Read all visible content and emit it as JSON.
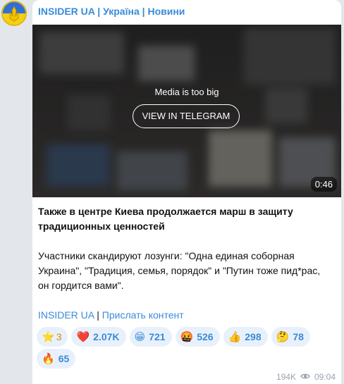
{
  "channel": {
    "name": "INSIDER UA | Україна | Новини"
  },
  "media": {
    "message": "Media is too big",
    "button_label": "VIEW IN TELEGRAM",
    "duration": "0:46"
  },
  "post": {
    "title": "Также в центре Киева продолжается марш в защиту традиционных ценностей",
    "body": "Участники скандируют лозунги: \"Одна единая соборная Украина\", \"Традиция, семья, порядок\" и \"Путин тоже пид*рас, он гордится вами\".",
    "link_channel": "INSIDER UA",
    "separator": " | ",
    "link_submit": "Прислать контент"
  },
  "reactions": [
    {
      "emoji": "⭐",
      "count": "3",
      "icon": "star-icon"
    },
    {
      "emoji": "❤️",
      "count": "2.07K",
      "icon": "heart-icon"
    },
    {
      "emoji": "😁",
      "count": "721",
      "icon": "grin-icon"
    },
    {
      "emoji": "🤬",
      "count": "526",
      "icon": "angry-icon"
    },
    {
      "emoji": "👍",
      "count": "298",
      "icon": "thumbs-up-icon"
    },
    {
      "emoji": "🤔",
      "count": "78",
      "icon": "thinking-icon"
    },
    {
      "emoji": "🔥",
      "count": "65",
      "icon": "fire-icon"
    }
  ],
  "meta": {
    "views": "194K",
    "time": "09:04"
  },
  "colors": {
    "accent": "#3a8bd8",
    "reaction_bg": "#e8f1fb"
  }
}
